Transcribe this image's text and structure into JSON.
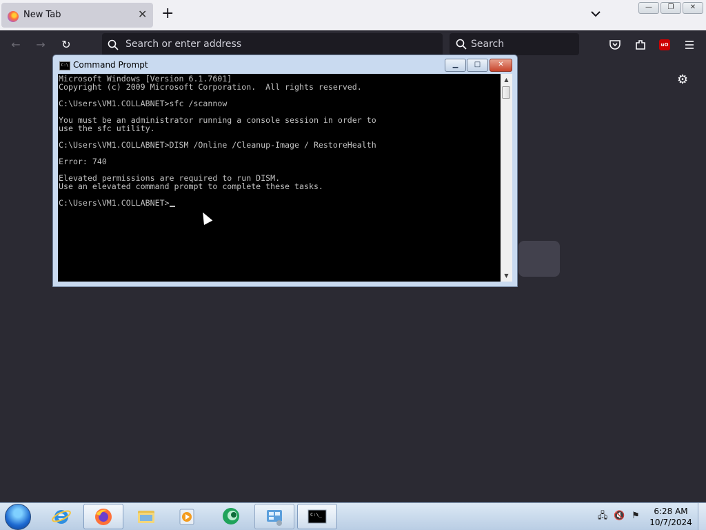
{
  "browser": {
    "tab": {
      "title": "New Tab",
      "close": "✕"
    },
    "new_tab": "+",
    "urlbar_placeholder": "Search or enter address",
    "search_placeholder": "Search",
    "ublock_badge": "uO"
  },
  "cmd": {
    "title": "Command Prompt",
    "lines": [
      "Microsoft Windows [Version 6.1.7601]",
      "Copyright (c) 2009 Microsoft Corporation.  All rights reserved.",
      "",
      "C:\\Users\\VM1.COLLABNET>sfc /scannow",
      "",
      "You must be an administrator running a console session in order to",
      "use the sfc utility.",
      "",
      "C:\\Users\\VM1.COLLABNET>DISM /Online /Cleanup-Image / RestoreHealth",
      "",
      "Error: 740",
      "",
      "Elevated permissions are required to run DISM.",
      "Use an elevated command prompt to complete these tasks.",
      "",
      "C:\\Users\\VM1.COLLABNET>"
    ]
  },
  "taskbar": {
    "clock_time": "6:28 AM",
    "clock_date": "10/7/2024",
    "apps": [
      "internet-explorer",
      "firefox",
      "file-explorer",
      "media-player",
      "app-green-circle",
      "control-panel",
      "command-prompt"
    ]
  },
  "colors": {
    "console_text": "#c0c0c0",
    "firefox_dark": "#2b2a33"
  }
}
